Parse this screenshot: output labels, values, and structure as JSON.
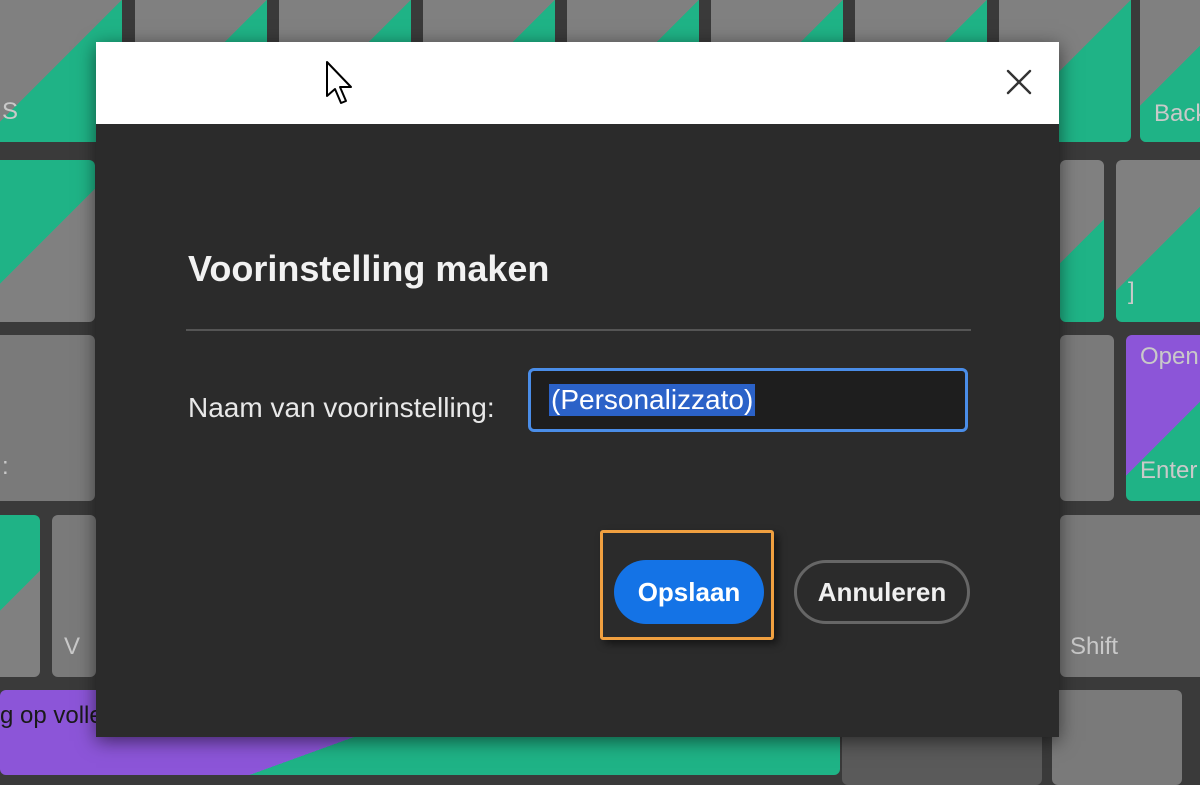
{
  "dialog": {
    "title": "Voorinstelling maken",
    "field_label": "Naam van voorinstelling:",
    "input_value": "(Personalizzato)",
    "save_label": "Opslaan",
    "cancel_label": "Annuleren",
    "close_icon": "close-icon"
  },
  "keyboard": {
    "keys": {
      "s": "S",
      "back": "Back",
      "bracket": "]",
      "open": "Open",
      "enter": "Enter",
      "colon": ":",
      "v": "V",
      "shift": "Shift",
      "fullscreen": "g op volle"
    }
  },
  "colors": {
    "accent": "#1473e6",
    "focus": "#f0a040",
    "selection": "#2b62c8",
    "key_teal": "#1fb386",
    "key_purple": "#8c55d8"
  }
}
